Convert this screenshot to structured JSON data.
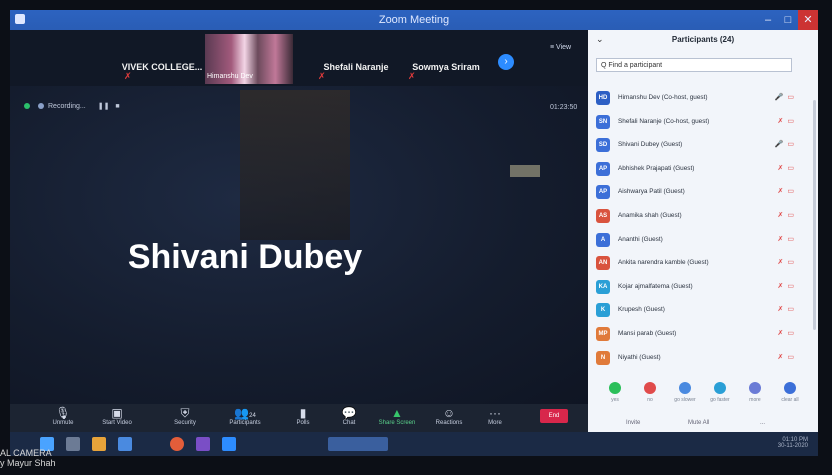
{
  "window": {
    "title": "Zoom Meeting"
  },
  "gallery": {
    "tiles": [
      "VIVEK COLLEGE...",
      "Shefali Naranje",
      "Sowmya Sriram"
    ],
    "video_tile_name": "Himanshu Dev",
    "view_label": "View"
  },
  "recording": {
    "label": "Recording...",
    "timer": "01:23:50"
  },
  "speaker": {
    "name": "Shivani Dubey"
  },
  "toolbar": {
    "items": [
      "Unmute",
      "Start Video",
      "Security",
      "Participants",
      "Polls",
      "Chat",
      "Share Screen",
      "Reactions",
      "More"
    ],
    "participants_count": "24",
    "end_label": "End"
  },
  "panel": {
    "title": "Participants (24)",
    "search_placeholder": "Q Find a participant",
    "participants": [
      {
        "initials": "HD",
        "name": "Himanshu Dev (Co-host, guest)",
        "color": "#2d5fc4",
        "mic": "on"
      },
      {
        "initials": "SN",
        "name": "Shefali Naranje (Co-host, guest)",
        "color": "#3c6fd8",
        "mic": "off"
      },
      {
        "initials": "SD",
        "name": "Shivani Dubey (Guest)",
        "color": "#3c6fd8",
        "mic": "on"
      },
      {
        "initials": "AP",
        "name": "Abhishek Prajapati (Guest)",
        "color": "#3c6fd8",
        "mic": "off"
      },
      {
        "initials": "AP",
        "name": "Aishwarya Patil (Guest)",
        "color": "#3c6fd8",
        "mic": "off"
      },
      {
        "initials": "AS",
        "name": "Anamika shah (Guest)",
        "color": "#d9533e",
        "mic": "off"
      },
      {
        "initials": "A",
        "name": "Ananthi (Guest)",
        "color": "#3c6fd8",
        "mic": "off"
      },
      {
        "initials": "AN",
        "name": "Ankita narendra kamble (Guest)",
        "color": "#d9533e",
        "mic": "off"
      },
      {
        "initials": "KA",
        "name": "Kojar ajmalfatema (Guest)",
        "color": "#2a9fd6",
        "mic": "off"
      },
      {
        "initials": "K",
        "name": "Krupesh (Guest)",
        "color": "#2a9fd6",
        "mic": "off"
      },
      {
        "initials": "MP",
        "name": "Mansi parab (Guest)",
        "color": "#e07a3a",
        "mic": "off"
      },
      {
        "initials": "N",
        "name": "Niyathi (Guest)",
        "color": "#e07a3a",
        "mic": "off"
      }
    ],
    "reactions": [
      {
        "label": "yes",
        "color": "#2bbf5a"
      },
      {
        "label": "no",
        "color": "#e04b4b"
      },
      {
        "label": "go slower",
        "color": "#4a8ae0"
      },
      {
        "label": "go faster",
        "color": "#2a9fd6"
      },
      {
        "label": "more",
        "color": "#6a7bd6"
      },
      {
        "label": "clear all",
        "color": "#3c6fd8"
      }
    ],
    "invite_label": "Invite",
    "mute_all_label": "Mute All",
    "more_label": "..."
  },
  "taskbar": {
    "time": "01:10 PM",
    "date": "30-11-2020"
  },
  "watermark": {
    "line1": "AL CAMERA",
    "line2": "y Mayur Shah"
  }
}
